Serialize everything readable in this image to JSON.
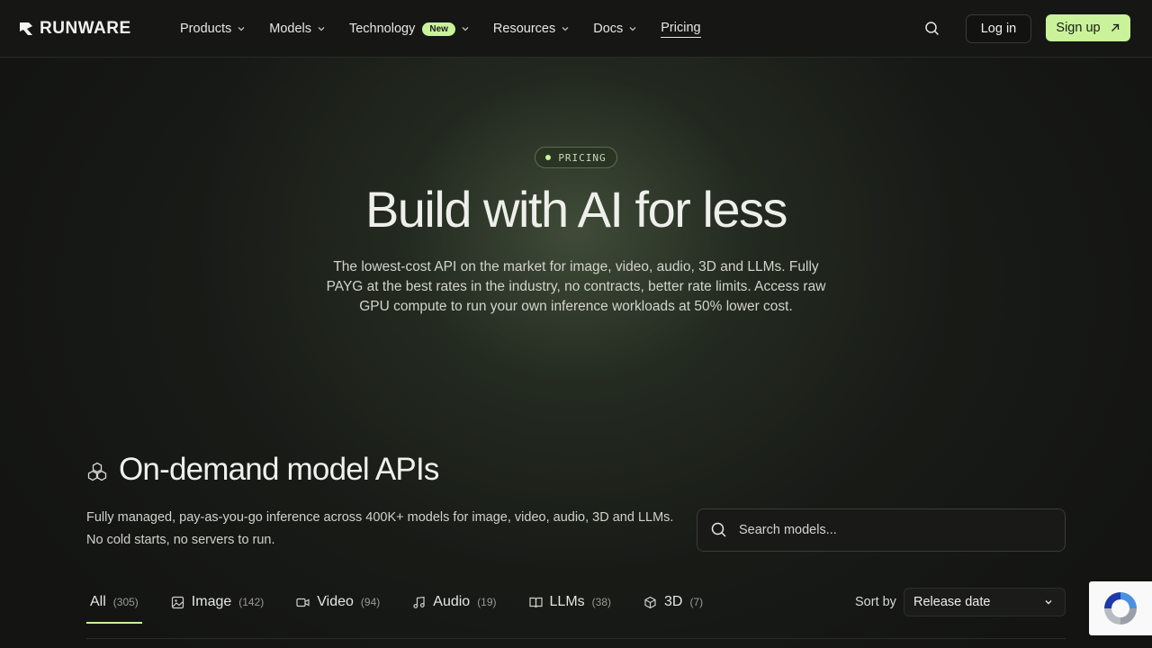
{
  "brand": {
    "name": "RUNWARE"
  },
  "nav": {
    "items": [
      {
        "label": "Products",
        "has_dropdown": true
      },
      {
        "label": "Models",
        "has_dropdown": true
      },
      {
        "label": "Technology",
        "badge": "New",
        "has_dropdown": true
      },
      {
        "label": "Resources",
        "has_dropdown": true
      },
      {
        "label": "Docs",
        "has_dropdown": true
      },
      {
        "label": "Pricing",
        "active": true
      }
    ],
    "login_label": "Log in",
    "signup_label": "Sign up"
  },
  "hero": {
    "pill_label": "PRICING",
    "title": "Build with AI for less",
    "subtitle": "The lowest-cost API on the market for image, video, audio, 3D and LLMs. Fully PAYG at the best rates in the industry, no contracts, better rate limits. Access raw GPU compute to run your own inference workloads at 50% lower cost."
  },
  "section": {
    "title": "On-demand model APIs",
    "description": "Fully managed, pay-as-you-go inference across 400K+ models for image, video, audio, 3D and LLMs. No cold starts, no servers to run.",
    "search_placeholder": "Search models..."
  },
  "tabs": [
    {
      "label": "All",
      "count": "(305)",
      "active": true,
      "icon": "none"
    },
    {
      "label": "Image",
      "count": "(142)",
      "icon": "image-icon"
    },
    {
      "label": "Video",
      "count": "(94)",
      "icon": "video-icon"
    },
    {
      "label": "Audio",
      "count": "(19)",
      "icon": "music-icon"
    },
    {
      "label": "LLMs",
      "count": "(38)",
      "icon": "book-icon"
    },
    {
      "label": "3D",
      "count": "(7)",
      "icon": "cube-icon"
    }
  ],
  "sort": {
    "label": "Sort by",
    "value": "Release date"
  },
  "colors": {
    "accent": "#c9f29a",
    "background": "#141513"
  }
}
